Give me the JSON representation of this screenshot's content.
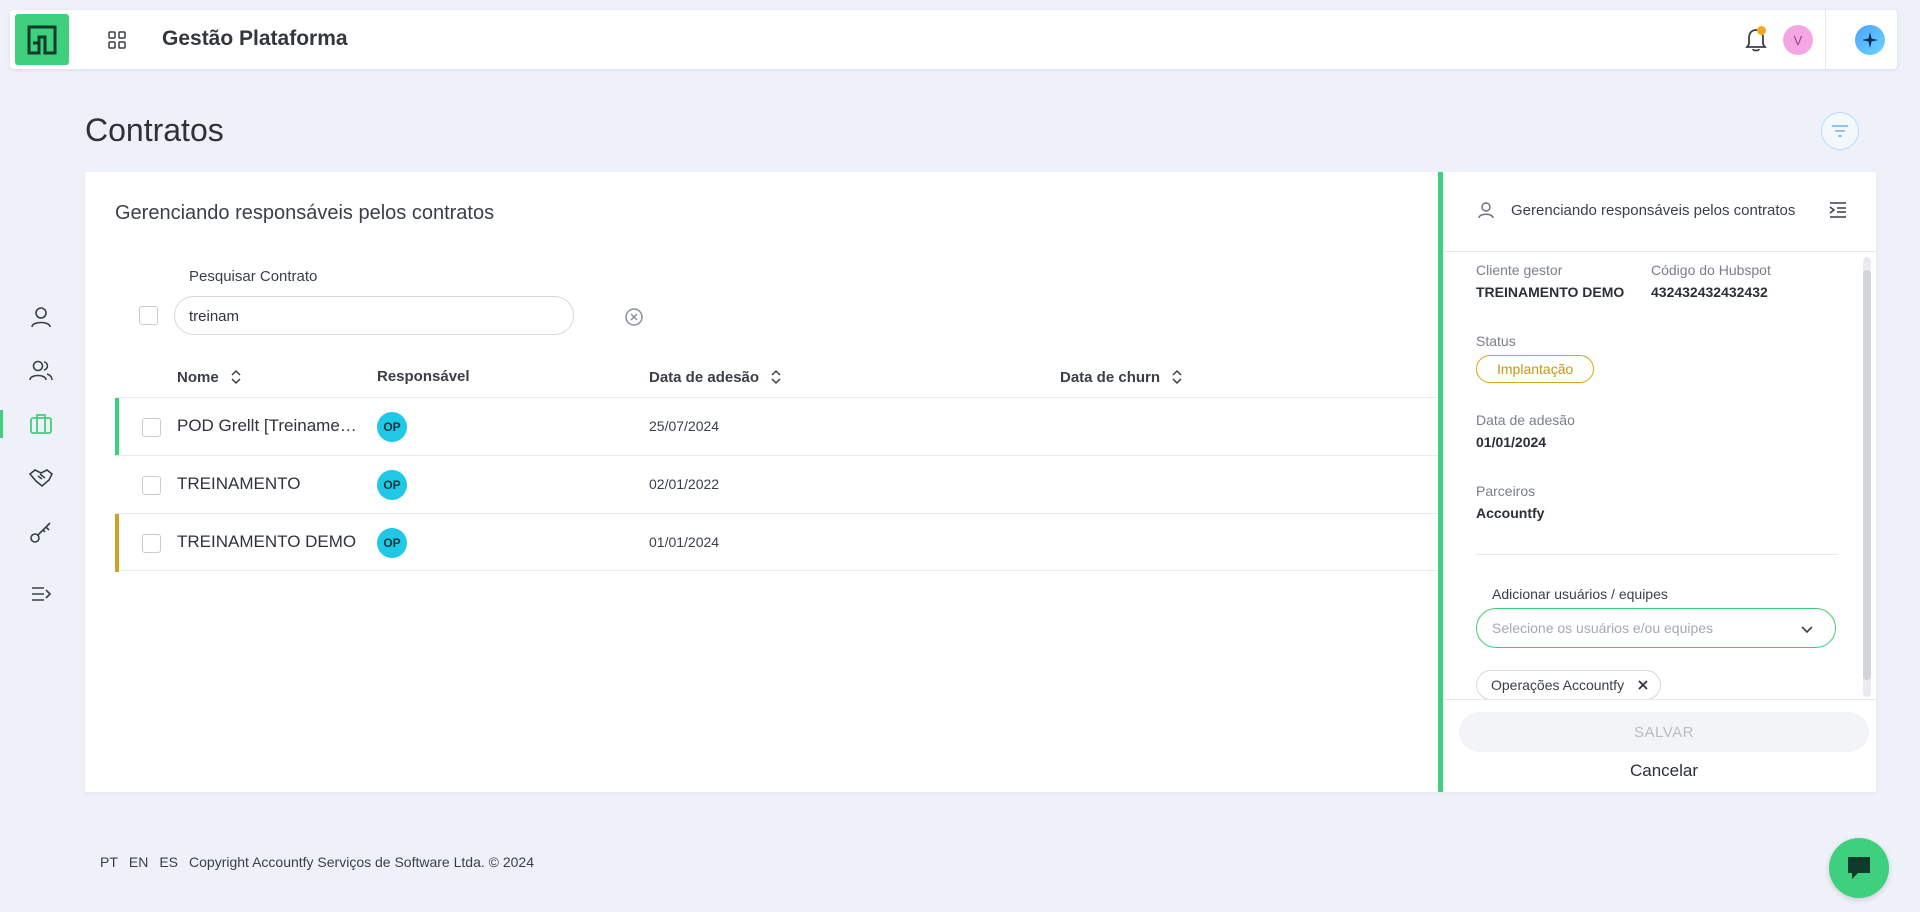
{
  "header": {
    "app_title": "Gestão Plataforma",
    "avatar_initial": "V"
  },
  "page": {
    "title": "Contratos"
  },
  "main": {
    "card_title": "Gerenciando responsáveis pelos contratos",
    "search": {
      "label": "Pesquisar Contrato",
      "value": "treinam"
    },
    "columns": {
      "name": "Nome",
      "responsible": "Responsável",
      "join_date": "Data de adesão",
      "churn_date": "Data de churn"
    },
    "rows": [
      {
        "name": "POD Grellt [Treinamento]",
        "responsible": "OP",
        "join_date": "25/07/2024",
        "accent": "#3ecf7f"
      },
      {
        "name": "TREINAMENTO",
        "responsible": "OP",
        "join_date": "02/01/2022",
        "accent": "transparent"
      },
      {
        "name": "TREINAMENTO DEMO",
        "responsible": "OP",
        "join_date": "01/01/2024",
        "accent": "#c9a227"
      }
    ]
  },
  "panel": {
    "title": "Gerenciando responsáveis pelos contratos",
    "client_label": "Cliente gestor",
    "client_value": "TREINAMENTO DEMO",
    "hubspot_label": "Código do Hubspot",
    "hubspot_value": "432432432432432",
    "status_label": "Status",
    "status_value": "Implantação",
    "join_label": "Data de adesão",
    "join_value": "01/01/2024",
    "partners_label": "Parceiros",
    "partners_value": "Accountfy",
    "add_label": "Adicionar usuários / equipes",
    "select_placeholder": "Selecione os usuários e/ou equipes",
    "chip_label": "Operações Accountfy",
    "save_label": "SALVAR",
    "cancel_label": "Cancelar"
  },
  "footer": {
    "lang_pt": "PT",
    "lang_en": "EN",
    "lang_es": "ES",
    "copyright": "Copyright Accountfy Serviços de Software Ltda. © 2024"
  },
  "colors": {
    "brand_green": "#3ecf7f",
    "op_badge": "#1fc9e6",
    "status_gold": "#c49612"
  }
}
